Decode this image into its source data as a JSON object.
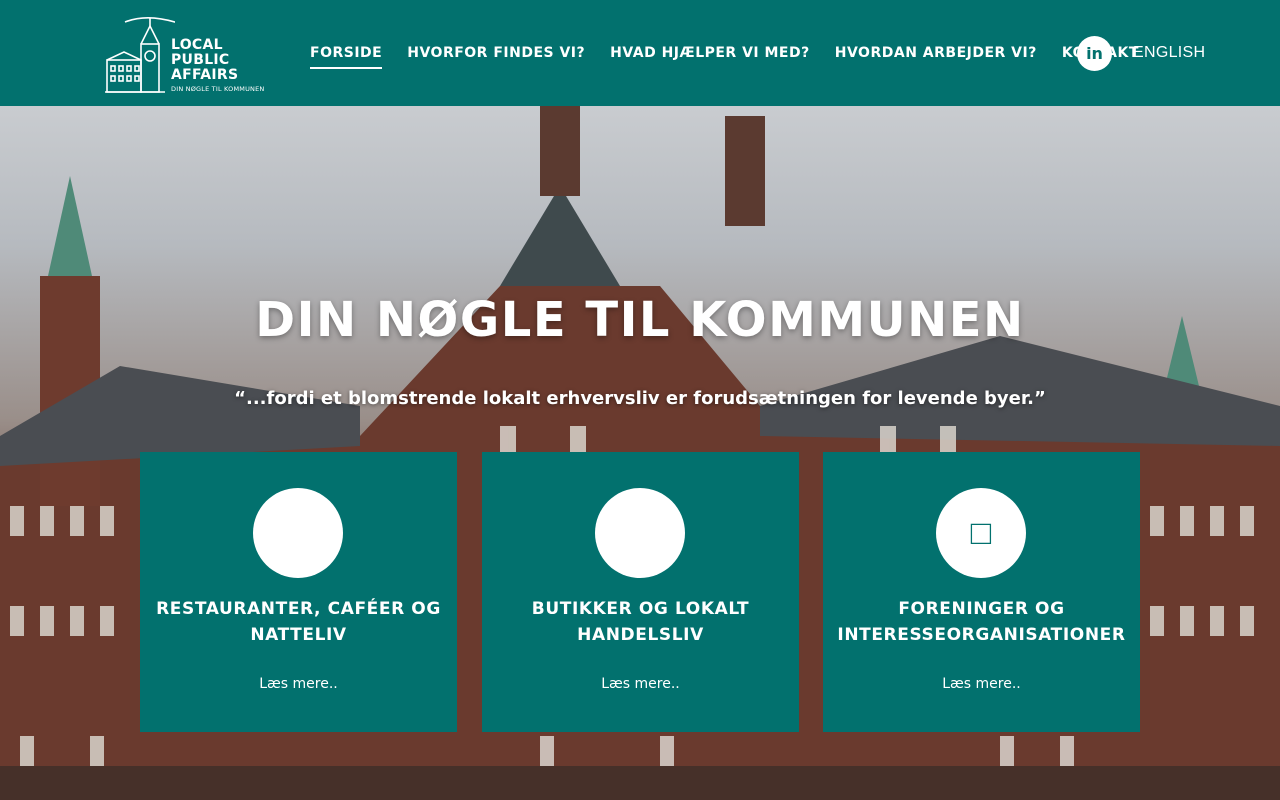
{
  "logo": {
    "line1": "LOCAL",
    "line2": "PUBLIC",
    "line3": "AFFAIRS",
    "tagline": "DIN NØGLE TIL KOMMUNEN"
  },
  "nav": {
    "items": [
      {
        "label": "FORSIDE",
        "active": true
      },
      {
        "label": "HVORFOR FINDES VI?"
      },
      {
        "label": "HVAD HJÆLPER VI MED?"
      },
      {
        "label": "HVORDAN ARBEJDER VI?"
      },
      {
        "label": "KONTAKT"
      }
    ],
    "linkedin_icon": "linkedin-icon",
    "linkedin_glyph": "in",
    "language": "ENGLISH"
  },
  "hero": {
    "title": "DIN NØGLE TIL KOMMUNEN",
    "quote": "“...fordi et blomstrende lokalt erhvervsliv er forudsætningen for levende byer.”"
  },
  "cards": [
    {
      "title": "RESTAURANTER, CAFÉER OG NATTELIV",
      "link": "Læs mere..",
      "icon": ""
    },
    {
      "title": "BUTIKKER OG LOKALT HANDELSLIV",
      "link": "Læs mere..",
      "icon": ""
    },
    {
      "title": "FORENINGER OG INTERESSEORGANISATIONER",
      "link": "Læs mere..",
      "icon": "□"
    }
  ],
  "colors": {
    "brand": "#02716e",
    "white": "#ffffff"
  }
}
